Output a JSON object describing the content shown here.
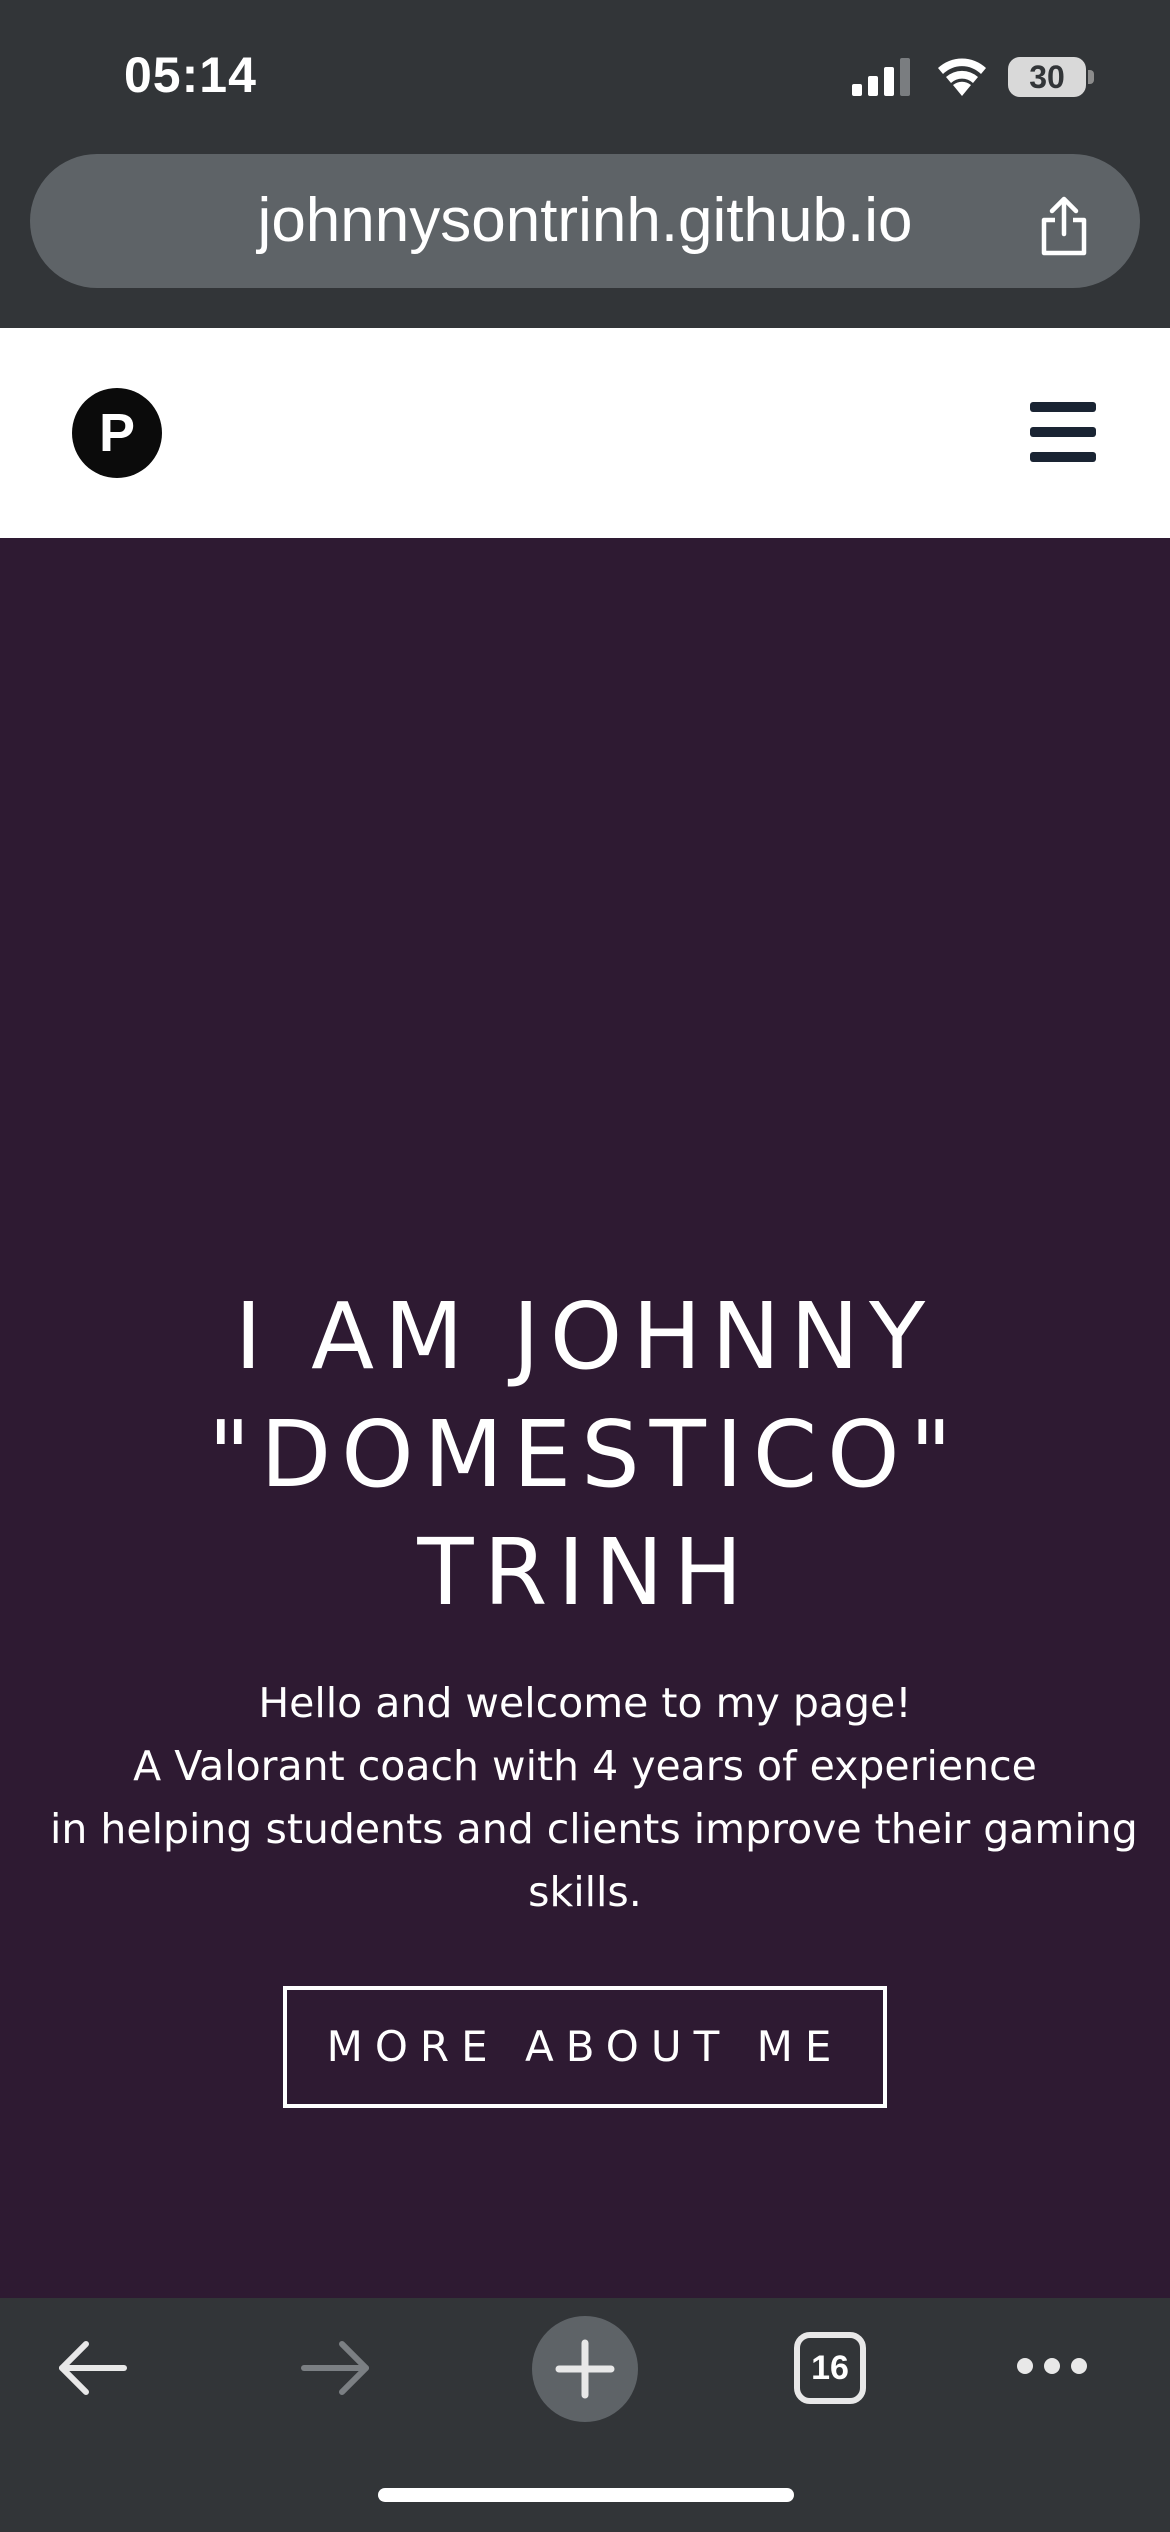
{
  "status_bar": {
    "time": "05:14",
    "battery": "30",
    "icons": [
      "signal-icon",
      "wifi-icon",
      "battery-icon"
    ]
  },
  "browser": {
    "url": "johnnysontrinh.github.io",
    "share_icon": "share-icon",
    "toolbar": {
      "tab_count": "16",
      "icons": [
        "back-arrow-icon",
        "forward-arrow-icon",
        "plus-icon",
        "tabs-icon",
        "more-icon"
      ]
    }
  },
  "site": {
    "logo_letter": "P",
    "menu_icon": "hamburger-menu-icon",
    "hero": {
      "title_lines": [
        "I AM JOHNNY",
        "\"DOMESTICO\"",
        "TRINH"
      ],
      "intro_lines": [
        "Hello and welcome to my page!",
        "A Valorant coach with 4 years of experience",
        "in helping students and clients improve their gaming",
        "skills."
      ],
      "cta_label": "MORE ABOUT ME"
    }
  },
  "colors": {
    "browser_chrome": "#323538",
    "address_bar": "#5e6367",
    "hero_background": "#2e1a32",
    "header_background": "#ffffff",
    "text_light": "#ffffff",
    "menu_icon": "#1a2433"
  }
}
